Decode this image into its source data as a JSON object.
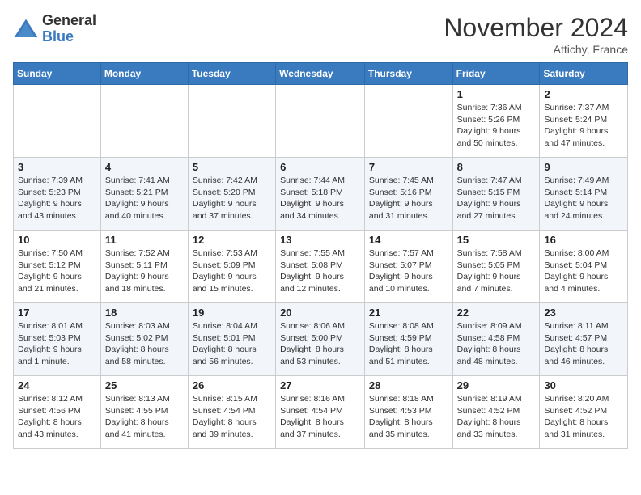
{
  "logo": {
    "general": "General",
    "blue": "Blue"
  },
  "title": "November 2024",
  "location": "Attichy, France",
  "days_of_week": [
    "Sunday",
    "Monday",
    "Tuesday",
    "Wednesday",
    "Thursday",
    "Friday",
    "Saturday"
  ],
  "weeks": [
    [
      {
        "day": "",
        "info": ""
      },
      {
        "day": "",
        "info": ""
      },
      {
        "day": "",
        "info": ""
      },
      {
        "day": "",
        "info": ""
      },
      {
        "day": "",
        "info": ""
      },
      {
        "day": "1",
        "info": "Sunrise: 7:36 AM\nSunset: 5:26 PM\nDaylight: 9 hours and 50 minutes."
      },
      {
        "day": "2",
        "info": "Sunrise: 7:37 AM\nSunset: 5:24 PM\nDaylight: 9 hours and 47 minutes."
      }
    ],
    [
      {
        "day": "3",
        "info": "Sunrise: 7:39 AM\nSunset: 5:23 PM\nDaylight: 9 hours and 43 minutes."
      },
      {
        "day": "4",
        "info": "Sunrise: 7:41 AM\nSunset: 5:21 PM\nDaylight: 9 hours and 40 minutes."
      },
      {
        "day": "5",
        "info": "Sunrise: 7:42 AM\nSunset: 5:20 PM\nDaylight: 9 hours and 37 minutes."
      },
      {
        "day": "6",
        "info": "Sunrise: 7:44 AM\nSunset: 5:18 PM\nDaylight: 9 hours and 34 minutes."
      },
      {
        "day": "7",
        "info": "Sunrise: 7:45 AM\nSunset: 5:16 PM\nDaylight: 9 hours and 31 minutes."
      },
      {
        "day": "8",
        "info": "Sunrise: 7:47 AM\nSunset: 5:15 PM\nDaylight: 9 hours and 27 minutes."
      },
      {
        "day": "9",
        "info": "Sunrise: 7:49 AM\nSunset: 5:14 PM\nDaylight: 9 hours and 24 minutes."
      }
    ],
    [
      {
        "day": "10",
        "info": "Sunrise: 7:50 AM\nSunset: 5:12 PM\nDaylight: 9 hours and 21 minutes."
      },
      {
        "day": "11",
        "info": "Sunrise: 7:52 AM\nSunset: 5:11 PM\nDaylight: 9 hours and 18 minutes."
      },
      {
        "day": "12",
        "info": "Sunrise: 7:53 AM\nSunset: 5:09 PM\nDaylight: 9 hours and 15 minutes."
      },
      {
        "day": "13",
        "info": "Sunrise: 7:55 AM\nSunset: 5:08 PM\nDaylight: 9 hours and 12 minutes."
      },
      {
        "day": "14",
        "info": "Sunrise: 7:57 AM\nSunset: 5:07 PM\nDaylight: 9 hours and 10 minutes."
      },
      {
        "day": "15",
        "info": "Sunrise: 7:58 AM\nSunset: 5:05 PM\nDaylight: 9 hours and 7 minutes."
      },
      {
        "day": "16",
        "info": "Sunrise: 8:00 AM\nSunset: 5:04 PM\nDaylight: 9 hours and 4 minutes."
      }
    ],
    [
      {
        "day": "17",
        "info": "Sunrise: 8:01 AM\nSunset: 5:03 PM\nDaylight: 9 hours and 1 minute."
      },
      {
        "day": "18",
        "info": "Sunrise: 8:03 AM\nSunset: 5:02 PM\nDaylight: 8 hours and 58 minutes."
      },
      {
        "day": "19",
        "info": "Sunrise: 8:04 AM\nSunset: 5:01 PM\nDaylight: 8 hours and 56 minutes."
      },
      {
        "day": "20",
        "info": "Sunrise: 8:06 AM\nSunset: 5:00 PM\nDaylight: 8 hours and 53 minutes."
      },
      {
        "day": "21",
        "info": "Sunrise: 8:08 AM\nSunset: 4:59 PM\nDaylight: 8 hours and 51 minutes."
      },
      {
        "day": "22",
        "info": "Sunrise: 8:09 AM\nSunset: 4:58 PM\nDaylight: 8 hours and 48 minutes."
      },
      {
        "day": "23",
        "info": "Sunrise: 8:11 AM\nSunset: 4:57 PM\nDaylight: 8 hours and 46 minutes."
      }
    ],
    [
      {
        "day": "24",
        "info": "Sunrise: 8:12 AM\nSunset: 4:56 PM\nDaylight: 8 hours and 43 minutes."
      },
      {
        "day": "25",
        "info": "Sunrise: 8:13 AM\nSunset: 4:55 PM\nDaylight: 8 hours and 41 minutes."
      },
      {
        "day": "26",
        "info": "Sunrise: 8:15 AM\nSunset: 4:54 PM\nDaylight: 8 hours and 39 minutes."
      },
      {
        "day": "27",
        "info": "Sunrise: 8:16 AM\nSunset: 4:54 PM\nDaylight: 8 hours and 37 minutes."
      },
      {
        "day": "28",
        "info": "Sunrise: 8:18 AM\nSunset: 4:53 PM\nDaylight: 8 hours and 35 minutes."
      },
      {
        "day": "29",
        "info": "Sunrise: 8:19 AM\nSunset: 4:52 PM\nDaylight: 8 hours and 33 minutes."
      },
      {
        "day": "30",
        "info": "Sunrise: 8:20 AM\nSunset: 4:52 PM\nDaylight: 8 hours and 31 minutes."
      }
    ]
  ]
}
